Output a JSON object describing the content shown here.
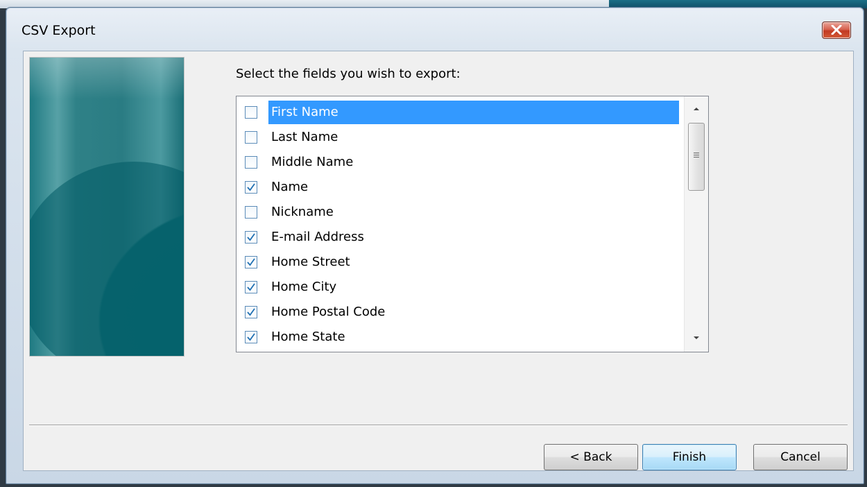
{
  "window": {
    "title": "CSV Export"
  },
  "main": {
    "prompt": "Select the fields you wish to export:",
    "fields": [
      {
        "label": "First Name",
        "checked": false,
        "selected": true
      },
      {
        "label": "Last Name",
        "checked": false,
        "selected": false
      },
      {
        "label": "Middle Name",
        "checked": false,
        "selected": false
      },
      {
        "label": "Name",
        "checked": true,
        "selected": false
      },
      {
        "label": "Nickname",
        "checked": false,
        "selected": false
      },
      {
        "label": "E-mail Address",
        "checked": true,
        "selected": false
      },
      {
        "label": "Home Street",
        "checked": true,
        "selected": false
      },
      {
        "label": "Home City",
        "checked": true,
        "selected": false
      },
      {
        "label": "Home Postal Code",
        "checked": true,
        "selected": false
      },
      {
        "label": "Home State",
        "checked": true,
        "selected": false
      }
    ]
  },
  "buttons": {
    "back": "< Back",
    "finish": "Finish",
    "cancel": "Cancel"
  },
  "colors": {
    "selection": "#3399ff",
    "checkmark": "#1f6fb2",
    "close_button": "#c23a22"
  },
  "icons": {
    "close": "close-icon",
    "check": "checkmark-icon",
    "scroll_up": "scroll-up-arrow-icon",
    "scroll_down": "scroll-down-arrow-icon"
  }
}
